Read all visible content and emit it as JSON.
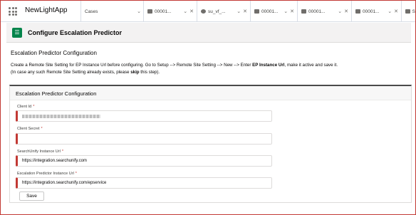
{
  "app": {
    "name": "NewLightApp"
  },
  "tabs": [
    {
      "label": "Cases",
      "icon": "none",
      "closable": false
    },
    {
      "label": "00001...",
      "icon": "case-icon",
      "closable": true
    },
    {
      "label": "su_vf_...",
      "icon": "visualforce-icon",
      "closable": true
    },
    {
      "label": "00001...",
      "icon": "case-icon",
      "closable": true
    },
    {
      "label": "00001...",
      "icon": "case-icon",
      "closable": true
    },
    {
      "label": "00001...",
      "icon": "case-icon",
      "closable": true
    },
    {
      "label": "S",
      "icon": "case-icon",
      "closable": false
    }
  ],
  "page": {
    "title": "Configure Escalation Predictor",
    "section_title": "Escalation Predictor Configuration",
    "instructions_line1_a": "Create a Remote Site Setting for EP Instance Url before configuring. Go to Setup --> Remote Site Setting --> New --> Enter ",
    "instructions_line1_bold": "EP Instance Url",
    "instructions_line1_b": ", make it active and save it.",
    "instructions_line2_a": "(In case any such Remote Site Setting already exists, please ",
    "instructions_line2_bold": "skip",
    "instructions_line2_b": " this step)."
  },
  "form": {
    "title": "Escalation Predictor Configuration",
    "fields": [
      {
        "label": "Client Id",
        "required_mark": "*",
        "value": "",
        "redacted": true
      },
      {
        "label": "Client Secret",
        "required_mark": "*",
        "value": "",
        "redacted": false
      },
      {
        "label": "SearchUnify Instance Url",
        "required_mark": "*",
        "value": "https://integration.searchunify.com",
        "redacted": false
      },
      {
        "label": "Escalation Predictor Instance Url",
        "required_mark": "*",
        "value": "https://integration.searchunify.com/epservice",
        "redacted": false
      }
    ],
    "save_label": "Save"
  }
}
